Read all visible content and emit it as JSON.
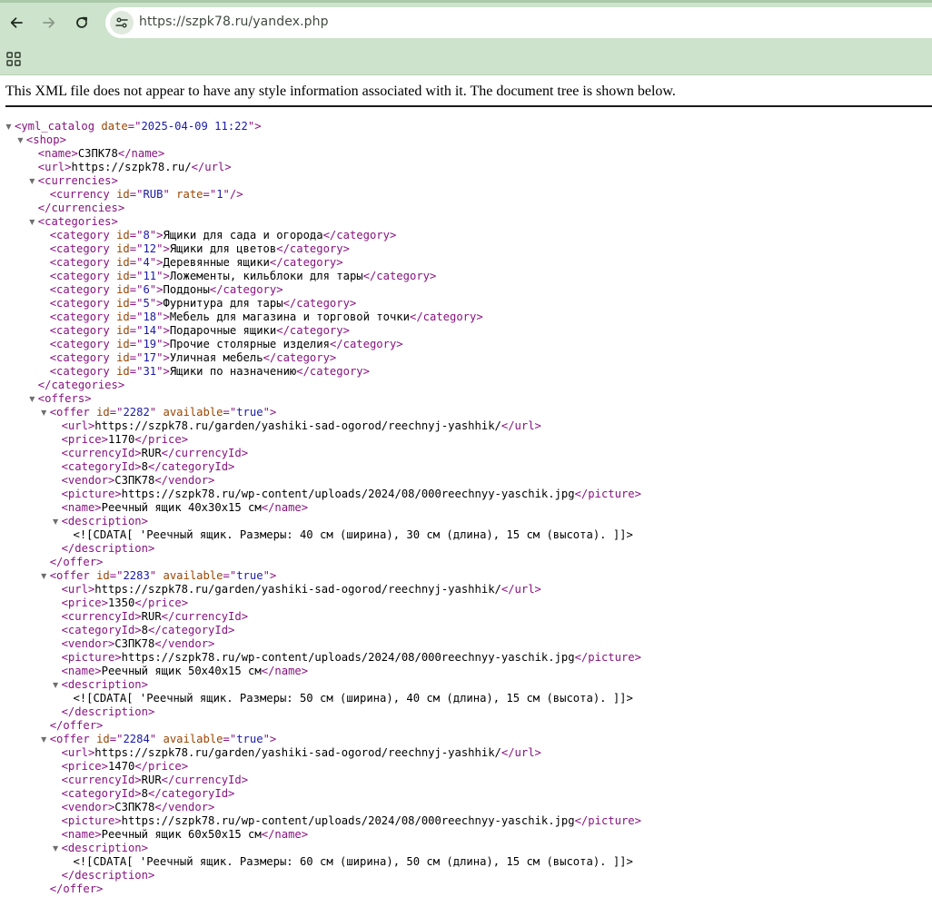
{
  "browser": {
    "url": "https://szpk78.ru/yandex.php",
    "icons": {
      "back": "arrow-left-icon",
      "forward": "arrow-right-icon",
      "reload": "reload-icon",
      "site_info": "tune-icon",
      "apps": "apps-grid-icon"
    }
  },
  "notice": "This XML file does not appear to have any style information associated with it. The document tree is shown below.",
  "xml": {
    "colors": {
      "tag": "#881280",
      "attr_name": "#994500",
      "attr_value": "#1a1aa6"
    },
    "lines": [
      {
        "indent": 0,
        "arrow": true,
        "parts": [
          [
            "t",
            "<yml_catalog"
          ],
          [
            "x",
            " "
          ],
          [
            "an",
            "date"
          ],
          [
            "t",
            "=\""
          ],
          [
            "av",
            "2025-04-09 11:22"
          ],
          [
            "t",
            "\">"
          ]
        ]
      },
      {
        "indent": 1,
        "arrow": true,
        "parts": [
          [
            "t",
            "<shop>"
          ]
        ]
      },
      {
        "indent": 2,
        "parts": [
          [
            "t",
            "<name>"
          ],
          [
            "x",
            "СЗПК78"
          ],
          [
            "t",
            "</name>"
          ]
        ]
      },
      {
        "indent": 2,
        "parts": [
          [
            "t",
            "<url>"
          ],
          [
            "x",
            "https://szpk78.ru/"
          ],
          [
            "t",
            "</url>"
          ]
        ]
      },
      {
        "indent": 2,
        "arrow": true,
        "parts": [
          [
            "t",
            "<currencies>"
          ]
        ]
      },
      {
        "indent": 3,
        "parts": [
          [
            "t",
            "<currency"
          ],
          [
            "x",
            " "
          ],
          [
            "an",
            "id"
          ],
          [
            "t",
            "=\""
          ],
          [
            "av",
            "RUB"
          ],
          [
            "t",
            "\""
          ],
          [
            "x",
            " "
          ],
          [
            "an",
            "rate"
          ],
          [
            "t",
            "=\""
          ],
          [
            "av",
            "1"
          ],
          [
            "t",
            "\"/>"
          ]
        ]
      },
      {
        "indent": 2,
        "parts": [
          [
            "t",
            "</currencies>"
          ]
        ]
      },
      {
        "indent": 2,
        "arrow": true,
        "parts": [
          [
            "t",
            "<categories>"
          ]
        ]
      },
      {
        "indent": 3,
        "parts": [
          [
            "t",
            "<category"
          ],
          [
            "x",
            " "
          ],
          [
            "an",
            "id"
          ],
          [
            "t",
            "=\""
          ],
          [
            "av",
            "8"
          ],
          [
            "t",
            "\">"
          ],
          [
            "x",
            "Ящики для сада и огорода"
          ],
          [
            "t",
            "</category>"
          ]
        ]
      },
      {
        "indent": 3,
        "parts": [
          [
            "t",
            "<category"
          ],
          [
            "x",
            " "
          ],
          [
            "an",
            "id"
          ],
          [
            "t",
            "=\""
          ],
          [
            "av",
            "12"
          ],
          [
            "t",
            "\">"
          ],
          [
            "x",
            "Ящики для цветов"
          ],
          [
            "t",
            "</category>"
          ]
        ]
      },
      {
        "indent": 3,
        "parts": [
          [
            "t",
            "<category"
          ],
          [
            "x",
            " "
          ],
          [
            "an",
            "id"
          ],
          [
            "t",
            "=\""
          ],
          [
            "av",
            "4"
          ],
          [
            "t",
            "\">"
          ],
          [
            "x",
            "Деревянные ящики"
          ],
          [
            "t",
            "</category>"
          ]
        ]
      },
      {
        "indent": 3,
        "parts": [
          [
            "t",
            "<category"
          ],
          [
            "x",
            " "
          ],
          [
            "an",
            "id"
          ],
          [
            "t",
            "=\""
          ],
          [
            "av",
            "11"
          ],
          [
            "t",
            "\">"
          ],
          [
            "x",
            "Ложементы, кильблоки для тары"
          ],
          [
            "t",
            "</category>"
          ]
        ]
      },
      {
        "indent": 3,
        "parts": [
          [
            "t",
            "<category"
          ],
          [
            "x",
            " "
          ],
          [
            "an",
            "id"
          ],
          [
            "t",
            "=\""
          ],
          [
            "av",
            "6"
          ],
          [
            "t",
            "\">"
          ],
          [
            "x",
            "Поддоны"
          ],
          [
            "t",
            "</category>"
          ]
        ]
      },
      {
        "indent": 3,
        "parts": [
          [
            "t",
            "<category"
          ],
          [
            "x",
            " "
          ],
          [
            "an",
            "id"
          ],
          [
            "t",
            "=\""
          ],
          [
            "av",
            "5"
          ],
          [
            "t",
            "\">"
          ],
          [
            "x",
            "Фурнитура для тары"
          ],
          [
            "t",
            "</category>"
          ]
        ]
      },
      {
        "indent": 3,
        "parts": [
          [
            "t",
            "<category"
          ],
          [
            "x",
            " "
          ],
          [
            "an",
            "id"
          ],
          [
            "t",
            "=\""
          ],
          [
            "av",
            "18"
          ],
          [
            "t",
            "\">"
          ],
          [
            "x",
            "Мебель для магазина и торговой точки"
          ],
          [
            "t",
            "</category>"
          ]
        ]
      },
      {
        "indent": 3,
        "parts": [
          [
            "t",
            "<category"
          ],
          [
            "x",
            " "
          ],
          [
            "an",
            "id"
          ],
          [
            "t",
            "=\""
          ],
          [
            "av",
            "14"
          ],
          [
            "t",
            "\">"
          ],
          [
            "x",
            "Подарочные ящики"
          ],
          [
            "t",
            "</category>"
          ]
        ]
      },
      {
        "indent": 3,
        "parts": [
          [
            "t",
            "<category"
          ],
          [
            "x",
            " "
          ],
          [
            "an",
            "id"
          ],
          [
            "t",
            "=\""
          ],
          [
            "av",
            "19"
          ],
          [
            "t",
            "\">"
          ],
          [
            "x",
            "Прочие столярные изделия"
          ],
          [
            "t",
            "</category>"
          ]
        ]
      },
      {
        "indent": 3,
        "parts": [
          [
            "t",
            "<category"
          ],
          [
            "x",
            " "
          ],
          [
            "an",
            "id"
          ],
          [
            "t",
            "=\""
          ],
          [
            "av",
            "17"
          ],
          [
            "t",
            "\">"
          ],
          [
            "x",
            "Уличная мебель"
          ],
          [
            "t",
            "</category>"
          ]
        ]
      },
      {
        "indent": 3,
        "parts": [
          [
            "t",
            "<category"
          ],
          [
            "x",
            " "
          ],
          [
            "an",
            "id"
          ],
          [
            "t",
            "=\""
          ],
          [
            "av",
            "31"
          ],
          [
            "t",
            "\">"
          ],
          [
            "x",
            "Ящики по назначению"
          ],
          [
            "t",
            "</category>"
          ]
        ]
      },
      {
        "indent": 2,
        "parts": [
          [
            "t",
            "</categories>"
          ]
        ]
      },
      {
        "indent": 2,
        "arrow": true,
        "parts": [
          [
            "t",
            "<offers>"
          ]
        ]
      },
      {
        "indent": 3,
        "arrow": true,
        "parts": [
          [
            "t",
            "<offer"
          ],
          [
            "x",
            " "
          ],
          [
            "an",
            "id"
          ],
          [
            "t",
            "=\""
          ],
          [
            "av",
            "2282"
          ],
          [
            "t",
            "\""
          ],
          [
            "x",
            " "
          ],
          [
            "an",
            "available"
          ],
          [
            "t",
            "=\""
          ],
          [
            "av",
            "true"
          ],
          [
            "t",
            "\">"
          ]
        ]
      },
      {
        "indent": 4,
        "parts": [
          [
            "t",
            "<url>"
          ],
          [
            "x",
            "https://szpk78.ru/garden/yashiki-sad-ogorod/reechnyj-yashhik/"
          ],
          [
            "t",
            "</url>"
          ]
        ]
      },
      {
        "indent": 4,
        "parts": [
          [
            "t",
            "<price>"
          ],
          [
            "x",
            "1170"
          ],
          [
            "t",
            "</price>"
          ]
        ]
      },
      {
        "indent": 4,
        "parts": [
          [
            "t",
            "<currencyId>"
          ],
          [
            "x",
            "RUR"
          ],
          [
            "t",
            "</currencyId>"
          ]
        ]
      },
      {
        "indent": 4,
        "parts": [
          [
            "t",
            "<categoryId>"
          ],
          [
            "x",
            "8"
          ],
          [
            "t",
            "</categoryId>"
          ]
        ]
      },
      {
        "indent": 4,
        "parts": [
          [
            "t",
            "<vendor>"
          ],
          [
            "x",
            "СЗПК78"
          ],
          [
            "t",
            "</vendor>"
          ]
        ]
      },
      {
        "indent": 4,
        "parts": [
          [
            "t",
            "<picture>"
          ],
          [
            "x",
            "https://szpk78.ru/wp-content/uploads/2024/08/000reechnyy-yaschik.jpg"
          ],
          [
            "t",
            "</picture>"
          ]
        ]
      },
      {
        "indent": 4,
        "parts": [
          [
            "t",
            "<name>"
          ],
          [
            "x",
            "Реечный ящик 40x30x15 см"
          ],
          [
            "t",
            "</name>"
          ]
        ]
      },
      {
        "indent": 4,
        "arrow": true,
        "parts": [
          [
            "t",
            "<description>"
          ]
        ]
      },
      {
        "indent": 5,
        "parts": [
          [
            "x",
            "<![CDATA[ 'Реечный ящик. Размеры: 40 см (ширина), 30 см (длина), 15 см (высота). ]]>"
          ]
        ]
      },
      {
        "indent": 4,
        "parts": [
          [
            "t",
            "</description>"
          ]
        ]
      },
      {
        "indent": 3,
        "parts": [
          [
            "t",
            "</offer>"
          ]
        ]
      },
      {
        "indent": 3,
        "arrow": true,
        "parts": [
          [
            "t",
            "<offer"
          ],
          [
            "x",
            " "
          ],
          [
            "an",
            "id"
          ],
          [
            "t",
            "=\""
          ],
          [
            "av",
            "2283"
          ],
          [
            "t",
            "\""
          ],
          [
            "x",
            " "
          ],
          [
            "an",
            "available"
          ],
          [
            "t",
            "=\""
          ],
          [
            "av",
            "true"
          ],
          [
            "t",
            "\">"
          ]
        ]
      },
      {
        "indent": 4,
        "parts": [
          [
            "t",
            "<url>"
          ],
          [
            "x",
            "https://szpk78.ru/garden/yashiki-sad-ogorod/reechnyj-yashhik/"
          ],
          [
            "t",
            "</url>"
          ]
        ]
      },
      {
        "indent": 4,
        "parts": [
          [
            "t",
            "<price>"
          ],
          [
            "x",
            "1350"
          ],
          [
            "t",
            "</price>"
          ]
        ]
      },
      {
        "indent": 4,
        "parts": [
          [
            "t",
            "<currencyId>"
          ],
          [
            "x",
            "RUR"
          ],
          [
            "t",
            "</currencyId>"
          ]
        ]
      },
      {
        "indent": 4,
        "parts": [
          [
            "t",
            "<categoryId>"
          ],
          [
            "x",
            "8"
          ],
          [
            "t",
            "</categoryId>"
          ]
        ]
      },
      {
        "indent": 4,
        "parts": [
          [
            "t",
            "<vendor>"
          ],
          [
            "x",
            "СЗПК78"
          ],
          [
            "t",
            "</vendor>"
          ]
        ]
      },
      {
        "indent": 4,
        "parts": [
          [
            "t",
            "<picture>"
          ],
          [
            "x",
            "https://szpk78.ru/wp-content/uploads/2024/08/000reechnyy-yaschik.jpg"
          ],
          [
            "t",
            "</picture>"
          ]
        ]
      },
      {
        "indent": 4,
        "parts": [
          [
            "t",
            "<name>"
          ],
          [
            "x",
            "Реечный ящик 50x40x15 см"
          ],
          [
            "t",
            "</name>"
          ]
        ]
      },
      {
        "indent": 4,
        "arrow": true,
        "parts": [
          [
            "t",
            "<description>"
          ]
        ]
      },
      {
        "indent": 5,
        "parts": [
          [
            "x",
            "<![CDATA[ 'Реечный ящик. Размеры: 50 см (ширина), 40 см (длина), 15 см (высота). ]]>"
          ]
        ]
      },
      {
        "indent": 4,
        "parts": [
          [
            "t",
            "</description>"
          ]
        ]
      },
      {
        "indent": 3,
        "parts": [
          [
            "t",
            "</offer>"
          ]
        ]
      },
      {
        "indent": 3,
        "arrow": true,
        "parts": [
          [
            "t",
            "<offer"
          ],
          [
            "x",
            " "
          ],
          [
            "an",
            "id"
          ],
          [
            "t",
            "=\""
          ],
          [
            "av",
            "2284"
          ],
          [
            "t",
            "\""
          ],
          [
            "x",
            " "
          ],
          [
            "an",
            "available"
          ],
          [
            "t",
            "=\""
          ],
          [
            "av",
            "true"
          ],
          [
            "t",
            "\">"
          ]
        ]
      },
      {
        "indent": 4,
        "parts": [
          [
            "t",
            "<url>"
          ],
          [
            "x",
            "https://szpk78.ru/garden/yashiki-sad-ogorod/reechnyj-yashhik/"
          ],
          [
            "t",
            "</url>"
          ]
        ]
      },
      {
        "indent": 4,
        "parts": [
          [
            "t",
            "<price>"
          ],
          [
            "x",
            "1470"
          ],
          [
            "t",
            "</price>"
          ]
        ]
      },
      {
        "indent": 4,
        "parts": [
          [
            "t",
            "<currencyId>"
          ],
          [
            "x",
            "RUR"
          ],
          [
            "t",
            "</currencyId>"
          ]
        ]
      },
      {
        "indent": 4,
        "parts": [
          [
            "t",
            "<categoryId>"
          ],
          [
            "x",
            "8"
          ],
          [
            "t",
            "</categoryId>"
          ]
        ]
      },
      {
        "indent": 4,
        "parts": [
          [
            "t",
            "<vendor>"
          ],
          [
            "x",
            "СЗПК78"
          ],
          [
            "t",
            "</vendor>"
          ]
        ]
      },
      {
        "indent": 4,
        "parts": [
          [
            "t",
            "<picture>"
          ],
          [
            "x",
            "https://szpk78.ru/wp-content/uploads/2024/08/000reechnyy-yaschik.jpg"
          ],
          [
            "t",
            "</picture>"
          ]
        ]
      },
      {
        "indent": 4,
        "parts": [
          [
            "t",
            "<name>"
          ],
          [
            "x",
            "Реечный ящик 60x50x15 см"
          ],
          [
            "t",
            "</name>"
          ]
        ]
      },
      {
        "indent": 4,
        "arrow": true,
        "parts": [
          [
            "t",
            "<description>"
          ]
        ]
      },
      {
        "indent": 5,
        "parts": [
          [
            "x",
            "<![CDATA[ 'Реечный ящик. Размеры: 60 см (ширина), 50 см (длина), 15 см (высота). ]]>"
          ]
        ]
      },
      {
        "indent": 4,
        "parts": [
          [
            "t",
            "</description>"
          ]
        ]
      },
      {
        "indent": 3,
        "parts": [
          [
            "t",
            "</offer>"
          ]
        ]
      }
    ]
  }
}
